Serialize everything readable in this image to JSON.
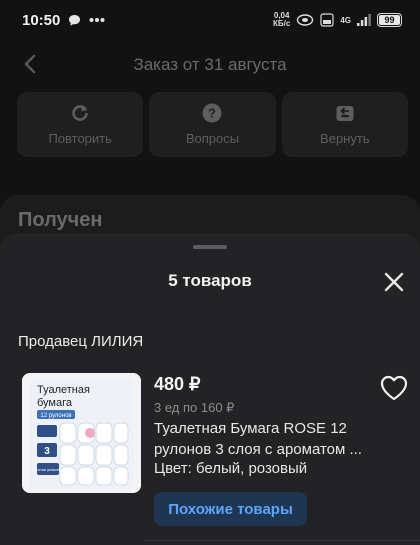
{
  "status_bar": {
    "time": "10:50",
    "net_speed_value": "0,04",
    "net_speed_unit": "КБ/с",
    "signal_label": "4G",
    "battery": "99"
  },
  "header": {
    "title": "Заказ от 31 августа"
  },
  "actions": [
    {
      "label": "Повторить",
      "icon": "refresh-icon"
    },
    {
      "label": "Вопросы",
      "icon": "question-icon"
    },
    {
      "label": "Вернуть",
      "icon": "return-icon"
    }
  ],
  "order_status": "Получен",
  "sheet": {
    "title": "5 товаров",
    "seller": "Продавец ЛИЛИЯ",
    "product": {
      "price": "480 ₽",
      "unit_price": "3 ед по 160 ₽",
      "name": "Туалетная Бумага ROSE 12 рулонов 3 слоя с ароматом ...",
      "color": "Цвет: белый, розовый",
      "similar_button": "Похожие товары",
      "image": {
        "line1": "Туалетная",
        "line2": "бумага",
        "badge": "12 рулонов",
        "layers": "3",
        "tag": "Сочная упаковка"
      }
    }
  },
  "colors": {
    "accent": "#5aa6ff",
    "accent_bg": "#1e3651",
    "sheet_bg": "#232325",
    "page_bg": "#121212"
  }
}
